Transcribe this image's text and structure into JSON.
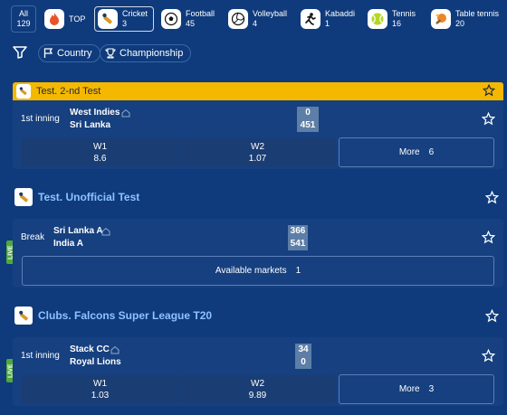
{
  "sports_bar": {
    "all_label": "All",
    "all_count": "129",
    "items": [
      {
        "label": "TOP",
        "count": "",
        "icon": "flame-icon"
      },
      {
        "label": "Cricket",
        "count": "3",
        "icon": "cricket-icon"
      },
      {
        "label": "Football",
        "count": "45",
        "icon": "football-icon"
      },
      {
        "label": "Volleyball",
        "count": "4",
        "icon": "volleyball-icon"
      },
      {
        "label": "Kabaddi",
        "count": "1",
        "icon": "kabaddi-icon"
      },
      {
        "label": "Tennis",
        "count": "16",
        "icon": "tennis-icon"
      },
      {
        "label": "Table tennis",
        "count": "20",
        "icon": "table-tennis-icon"
      }
    ]
  },
  "filters": {
    "country": "Country",
    "championship": "Championship"
  },
  "leagues": [
    {
      "title": "Test. 2-nd Test",
      "match": {
        "status": "1st inning",
        "team1": "West Indies",
        "team2": "Sri Lanka",
        "score1": "0",
        "score2": "451",
        "w1_label": "W1",
        "w1": "8.6",
        "w2_label": "W2",
        "w2": "1.07",
        "more_label": "More",
        "more_count": "6"
      }
    },
    {
      "title": "Test. Unofficial Test",
      "match": {
        "live": "LIVE",
        "status": "Break",
        "team1": "Sri Lanka A",
        "team2": "India A",
        "score1": "366",
        "score2": "541",
        "markets_label": "Available markets",
        "markets_count": "1"
      }
    },
    {
      "title": "Clubs. Falcons Super League T20",
      "match": {
        "live": "LIVE",
        "status": "1st inning",
        "team1": "Stack CC",
        "team2": "Royal Lions",
        "score1": "34",
        "score2": "0",
        "w1_label": "W1",
        "w1": "1.03",
        "w2_label": "W2",
        "w2": "9.89",
        "more_label": "More",
        "more_count": "3"
      }
    }
  ],
  "colors": {
    "background": "#0f3b7c",
    "card": "#16407f",
    "accent_yellow": "#f5b800",
    "league_title": "#8ec2ff",
    "live_green": "#4fa83b"
  }
}
